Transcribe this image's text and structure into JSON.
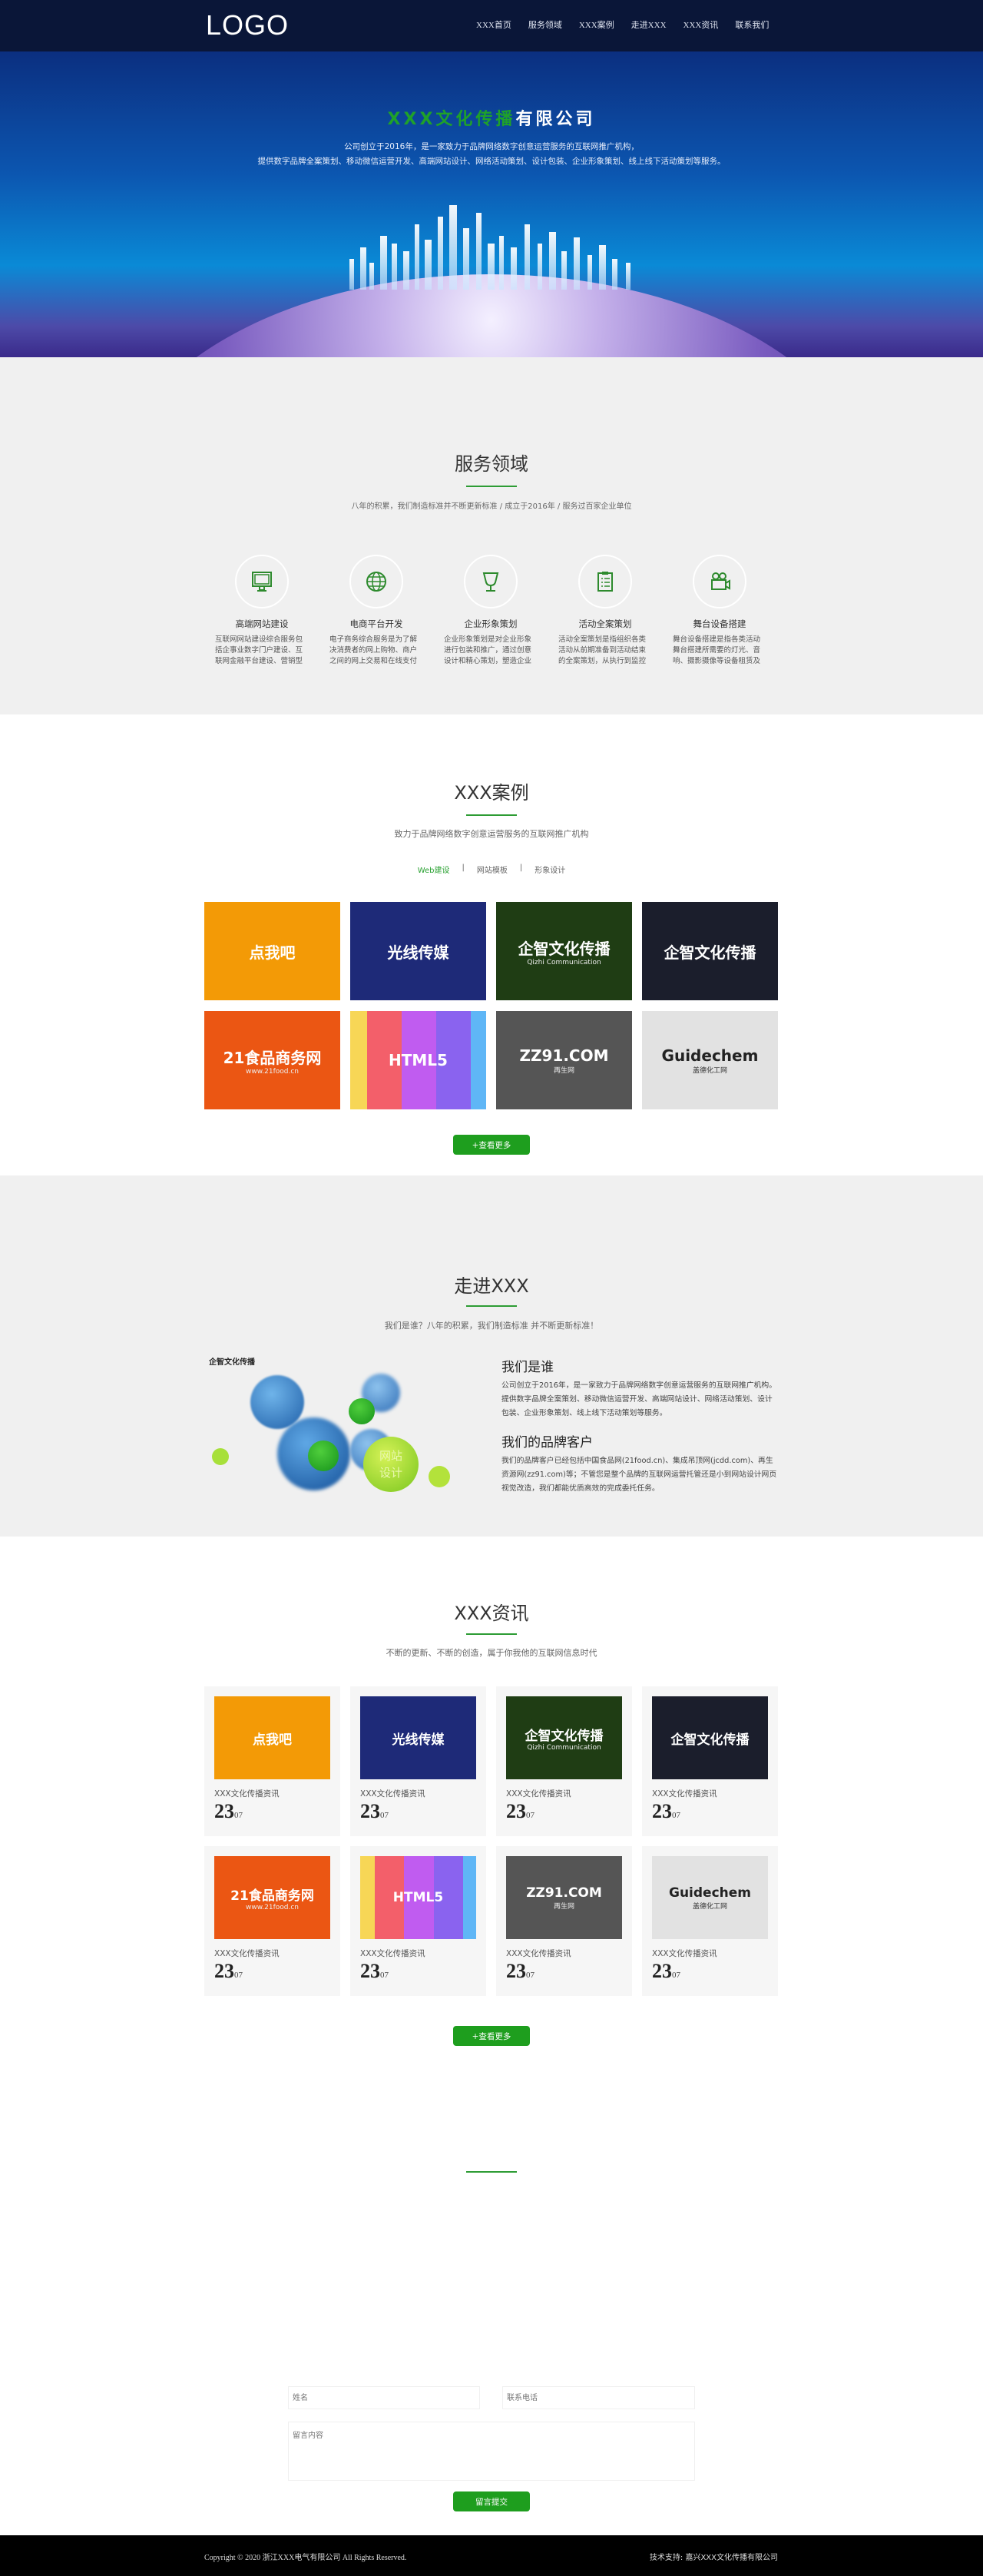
{
  "header": {
    "logo": "LOGO",
    "nav": [
      "XXX首页",
      "服务领域",
      "XXX案例",
      "走进XXX",
      "XXX资讯",
      "联系我们"
    ]
  },
  "hero": {
    "title_green": "XXX文化传播",
    "title_white": "有限公司",
    "desc1": "公司创立于2016年，是一家致力于品牌网络数字创意运营服务的互联网推广机构，",
    "desc2": "提供数字品牌全案策划、移动微信运营开发、高端网站设计、网络活动策划、设计包装、企业形象策划、线上线下活动策划等服务。"
  },
  "services": {
    "title": "服务领域",
    "subtitle": "八年的积累，我们制造标准并不断更新标准 / 成立于2016年 / 服务过百家企业单位",
    "items": [
      {
        "icon": "monitor-icon",
        "name": "高端网站建设",
        "desc": "互联网网站建设综合服务包括企事业数字门户建设、互联网金融平台建设、营销型网站建设"
      },
      {
        "icon": "globe-icon",
        "name": "电商平台开发",
        "desc": "电子商务综合服务是为了解决消费者的网上购物、商户之间的网上交易和在线支付问题，"
      },
      {
        "icon": "trophy-icon",
        "name": "企业形象策划",
        "desc": "企业形象策划是对企业形象进行包装和推广，通过创意设计和精心策划，塑造企业独特的"
      },
      {
        "icon": "clipboard-icon",
        "name": "活动全案策划",
        "desc": "活动全案策划是指组织各类活动从前期准备到活动结束的全案策划，从执行到监控的全程"
      },
      {
        "icon": "video-camera-icon",
        "name": "舞台设备搭建",
        "desc": "舞台设备搭建是指各类活动舞台搭建所需要的灯光、音响、摄影摄像等设备租赁及全程管"
      }
    ]
  },
  "cases": {
    "title": "XXX案例",
    "subtitle": "致力于品牌网络数字创意运营服务的互联网推广机构",
    "tabs": [
      "Web建设",
      "网站模板",
      "形象设计"
    ],
    "more": "+查看更多",
    "tiles": [
      {
        "text": "点我吧",
        "bg": "#f39a06"
      },
      {
        "text": "光线传媒",
        "bg": "#1e2a78"
      },
      {
        "text": "企智文化传播",
        "sub": "Qizhi Communication",
        "bg": "#1f3d14"
      },
      {
        "text": "企智文化传播",
        "bg": "#1b1e2c"
      },
      {
        "text": "21食品商务网",
        "sub": "www.21food.cn",
        "bg": "#eb5613"
      },
      {
        "text": "HTML5",
        "bg": "#f35f6a"
      },
      {
        "text": "ZZ91.COM",
        "sub": "再生网",
        "bg": "#555555"
      },
      {
        "text": "Guidechem",
        "sub": "盖德化工网",
        "bg": "#e2e2e2"
      }
    ]
  },
  "about": {
    "title": "走进XXX",
    "subtitle": "我们是谁？八年的积累，我们制造标准 并不断更新标准！",
    "img_logo": "企智文化传播",
    "bubble1": "网站",
    "bubble2": "设计",
    "h1": "我们是谁",
    "p1": "公司创立于2016年，是一家致力于品牌网络数字创意运营服务的互联网推广机构。提供数字品牌全案策划、移动微信运营开发、高端网站设计、网络活动策划、设计包装、企业形象策划、线上线下活动策划等服务。",
    "h2": "我们的品牌客户",
    "p2": "我们的品牌客户已经包括中国食品网(21food.cn)、集成吊顶网(jcdd.com)、再生资源网(zz91.com)等；不管您是整个品牌的互联网运营托管还是小到网站设计网页视觉改造，我们都能优质高效的完成委托任务。"
  },
  "news": {
    "title": "XXX资讯",
    "subtitle": "不断的更新、不断的创造，属于你我他的互联网信息时代",
    "more": "+查看更多",
    "items": [
      {
        "title": "XXX文化传播资讯",
        "day": "23",
        "month": "07"
      },
      {
        "title": "XXX文化传播资讯",
        "day": "23",
        "month": "07"
      },
      {
        "title": "XXX文化传播资讯",
        "day": "23",
        "month": "07"
      },
      {
        "title": "XXX文化传播资讯",
        "day": "23",
        "month": "07"
      },
      {
        "title": "XXX文化传播资讯",
        "day": "23",
        "month": "07"
      },
      {
        "title": "XXX文化传播资讯",
        "day": "23",
        "month": "07"
      },
      {
        "title": "XXX文化传播资讯",
        "day": "23",
        "month": "07"
      },
      {
        "title": "XXX文化传播资讯",
        "day": "23",
        "month": "07"
      }
    ]
  },
  "contact": {
    "name_placeholder": "姓名",
    "phone_placeholder": "联系电话",
    "message_placeholder": "留言内容",
    "submit": "留言提交"
  },
  "footer": {
    "copyright": "Copyright © 2020 浙江XXX电气有限公司 All Rights Reserved.",
    "support": "技术支持: 嘉兴XXX文化传播有限公司"
  },
  "colors": {
    "accent": "#1e9e1e",
    "header": "#0a1638",
    "footer": "#000000"
  }
}
